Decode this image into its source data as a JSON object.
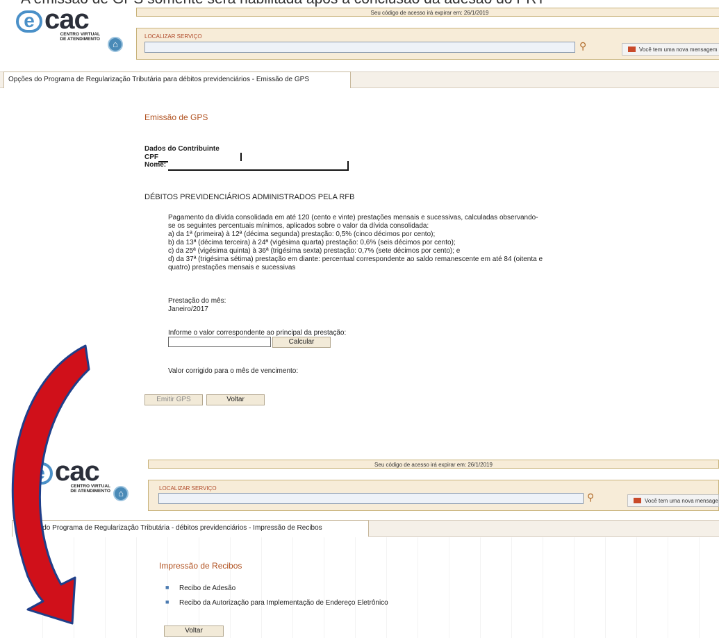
{
  "caption": "A emissão de GPS somente será habilitada após a conclusão da adesão do PRT",
  "screen1": {
    "logo": {
      "brand": "cac",
      "subtitle_line1": "CENTRO VIRTUAL",
      "subtitle_line2": "DE ATENDIMENTO"
    },
    "expire_notice": "Seu código de acesso irá expirar em: 26/1/2019",
    "search_label": "LOCALIZAR SERVIÇO",
    "message_button": "Você tem uma nova mensagem",
    "tab_title": "Opções do Programa de Regularização Tributária para débitos previdenciários - Emissão de GPS",
    "page_title": "Emissão de GPS",
    "contributor_heading": "Dados do Contribuinte",
    "cpf_label": "CPF:",
    "name_label": "Nome:",
    "section_heading": "DÉBITOS PREVIDENCIÁRIOS ADMINISTRADOS PELA RFB",
    "description_lines": [
      "Pagamento da dívida consolidada em até 120 (cento e vinte) prestações mensais e sucessivas, calculadas observando-",
      "se os seguintes percentuais mínimos, aplicados sobre o valor da dívida consolidada:",
      "a) da 1ª (primeira) à 12ª (décima segunda) prestação: 0,5% (cinco décimos por cento);",
      "b) da 13ª (décima terceira) à 24ª (vigésima quarta) prestação: 0,6% (seis décimos por cento);",
      "c) da 25ª (vigésima quinta) à 36ª (trigésima sexta) prestação: 0,7% (sete décimos por cento); e",
      "d) da 37ª (trigésima sétima) prestação em diante: percentual correspondente ao saldo remanescente em até 84 (oitenta e",
      "quatro) prestações mensais e sucessivas"
    ],
    "installment_label": "Prestação do mês:",
    "installment_value": "Janeiro/2017",
    "principal_prompt": "Informe o valor correspondente ao principal da prestação:",
    "calculate_button": "Calcular",
    "corrected_label": "Valor corrigido para o mês de vencimento:",
    "emit_button": "Emitir GPS",
    "back_button": "Voltar"
  },
  "screen2": {
    "logo": {
      "brand": "cac",
      "subtitle_line1": "CENTRO VIRTUAL",
      "subtitle_line2": "DE ATENDIMENTO"
    },
    "expire_notice": "Seu código de acesso irá expirar em: 26/1/2019",
    "search_label": "LOCALIZAR SERVIÇO",
    "message_button": "Você tem uma nova mensagem",
    "tab_title": "Opções do Programa de Regularização Tributária - débitos previdenciários - Impressão de Recibos",
    "page_title": "Impressão de Recibos",
    "receipts": [
      "Recibo de Adesão",
      "Recibo da Autorização para Implementação de Endereço Eletrônico"
    ],
    "back_button": "Voltar"
  },
  "colors": {
    "arrow_fill": "#d0101a",
    "arrow_outline": "#1f3f8a",
    "accent_title": "#b0501e"
  }
}
